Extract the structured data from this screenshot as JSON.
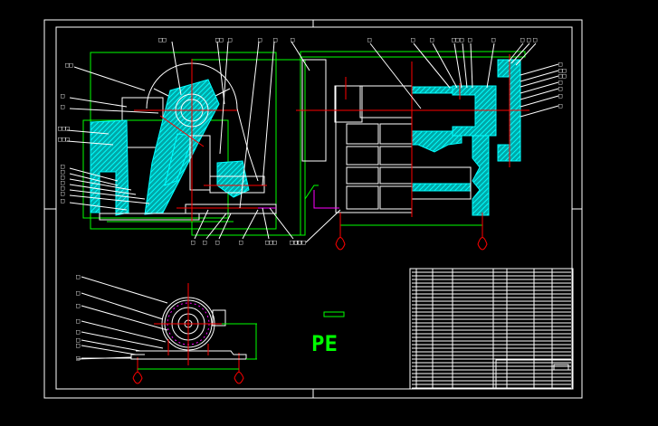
{
  "drawing": {
    "background": "#000000",
    "colors": {
      "outline": "#ffffff",
      "dimension": "#00ff00",
      "centerline": "#ff0000",
      "section_hatch": "#00ffff",
      "marker": "#ff00ff"
    },
    "views": [
      "side-section-view",
      "front-section-view",
      "motor-base-view",
      "title-block"
    ]
  },
  "labels": {
    "left_top": [
      "□□",
      "□□",
      "□",
      "□",
      "□",
      "□"
    ],
    "left_side": [
      "□□",
      "□",
      "□",
      "□□□",
      "□□□",
      "□",
      "□",
      "□",
      "□",
      "□",
      "□",
      "□"
    ],
    "left_bottom": [
      "□",
      "□",
      "□",
      "□",
      "□□□",
      "□□□"
    ],
    "right_top": [
      "□",
      "□",
      "□",
      "□□",
      "□",
      "□",
      "□",
      "□",
      "□",
      "□"
    ],
    "right_side": [
      "□",
      "□□",
      "□□",
      "□",
      "□",
      "□",
      "□"
    ],
    "right_bottom": "□□□",
    "motor_side": [
      "□",
      "□",
      "□",
      "□",
      "□",
      "□",
      "□",
      "□"
    ]
  },
  "logo_text": "PE",
  "title_block": {
    "label": "title-block"
  }
}
